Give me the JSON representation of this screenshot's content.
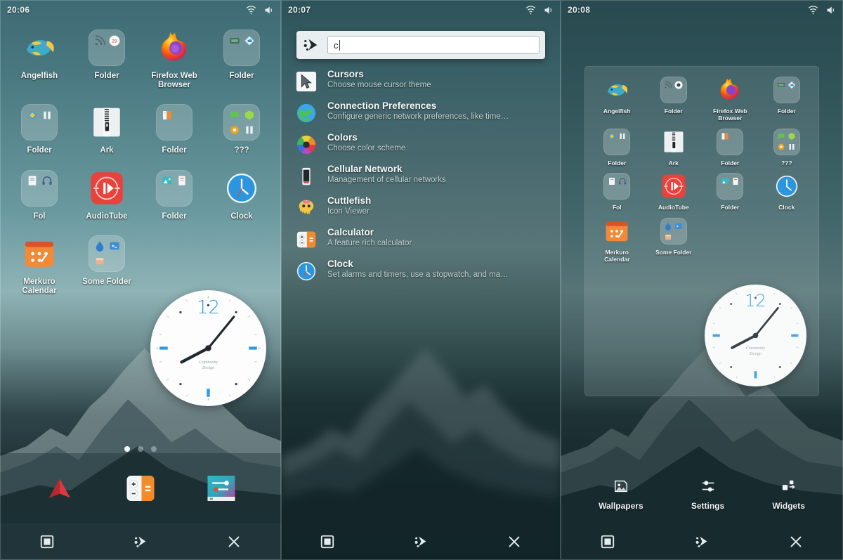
{
  "panels": [
    {
      "id": "home-screen",
      "status": {
        "time": "20:06",
        "wifi_icon": "wifi-icon",
        "volume_icon": "volume-icon"
      },
      "icons": [
        {
          "label": "Angelfish",
          "icon": "angelfish-icon",
          "kind": "app"
        },
        {
          "label": "Folder",
          "icon": "folder-group",
          "kind": "folder"
        },
        {
          "label": "Firefox Web Browser",
          "icon": "firefox-icon",
          "kind": "app"
        },
        {
          "label": "Folder",
          "icon": "folder-group",
          "kind": "folder"
        },
        {
          "label": "Folder",
          "icon": "folder-group",
          "kind": "folder"
        },
        {
          "label": "Ark",
          "icon": "ark-icon",
          "kind": "app"
        },
        {
          "label": "Folder",
          "icon": "folder-group",
          "kind": "folder"
        },
        {
          "label": "???",
          "icon": "folder-group",
          "kind": "folder"
        },
        {
          "label": "Fol",
          "icon": "folder-group",
          "kind": "folder"
        },
        {
          "label": "AudioTube",
          "icon": "audiotube-icon",
          "kind": "app"
        },
        {
          "label": "Folder",
          "icon": "folder-group",
          "kind": "folder"
        },
        {
          "label": "Clock",
          "icon": "clock-icon",
          "kind": "app"
        },
        {
          "label": "Merkuro Calendar",
          "icon": "merkuro-icon",
          "kind": "app"
        },
        {
          "label": "Some Folder",
          "icon": "folder-group",
          "kind": "folder"
        }
      ],
      "clock_widget": {
        "hour_label": "12",
        "brand_line1": "Community",
        "brand_line2": "Design"
      },
      "page_dots": {
        "count": 3,
        "active": 0
      },
      "dock": [
        {
          "name": "arrow-app-icon",
          "label": ""
        },
        {
          "name": "calculator-app-icon",
          "label": ""
        },
        {
          "name": "settings-app-icon",
          "label": ""
        }
      ],
      "nav": [
        {
          "name": "overview-button",
          "glyph": "square"
        },
        {
          "name": "home-button",
          "glyph": "kde"
        },
        {
          "name": "back-button",
          "glyph": "cross"
        }
      ]
    },
    {
      "id": "search-overlay",
      "status": {
        "time": "20:07",
        "wifi_icon": "wifi-icon",
        "volume_icon": "volume-icon"
      },
      "search": {
        "value": "c",
        "placeholder": "",
        "launcher_icon": "kde-plasma-icon"
      },
      "results": [
        {
          "name": "Cursors",
          "desc": "Choose mouse cursor theme",
          "icon": "cursor-icon"
        },
        {
          "name": "Connection Preferences",
          "desc": "Configure generic network preferences, like time…",
          "icon": "globe-icon"
        },
        {
          "name": "Colors",
          "desc": "Choose color scheme",
          "icon": "colorwheel-icon"
        },
        {
          "name": "Cellular Network",
          "desc": "Management of cellular networks",
          "icon": "phone-icon"
        },
        {
          "name": "Cuttlefish",
          "desc": "Icon Viewer",
          "icon": "cuttlefish-icon"
        },
        {
          "name": "Calculator",
          "desc": "A feature rich calculator",
          "icon": "calculator-icon"
        },
        {
          "name": "Clock",
          "desc": "Set alarms and timers, use a stopwatch, and ma…",
          "icon": "clock-icon"
        }
      ],
      "nav": [
        {
          "name": "overview-button",
          "glyph": "square"
        },
        {
          "name": "home-button",
          "glyph": "kde"
        },
        {
          "name": "back-button",
          "glyph": "cross"
        }
      ]
    },
    {
      "id": "edit-mode",
      "status": {
        "time": "20:08",
        "wifi_icon": "wifi-icon",
        "volume_icon": "volume-icon"
      },
      "icons": [
        {
          "label": "Angelfish",
          "icon": "angelfish-icon",
          "kind": "app"
        },
        {
          "label": "Folder",
          "icon": "folder-group",
          "kind": "folder"
        },
        {
          "label": "Firefox Web Browser",
          "icon": "firefox-icon",
          "kind": "app"
        },
        {
          "label": "Folder",
          "icon": "folder-group",
          "kind": "folder"
        },
        {
          "label": "Folder",
          "icon": "folder-group",
          "kind": "folder"
        },
        {
          "label": "Ark",
          "icon": "ark-icon",
          "kind": "app"
        },
        {
          "label": "Folder",
          "icon": "folder-group",
          "kind": "folder"
        },
        {
          "label": "???",
          "icon": "folder-group",
          "kind": "folder"
        },
        {
          "label": "Fol",
          "icon": "folder-group",
          "kind": "folder"
        },
        {
          "label": "AudioTube",
          "icon": "audiotube-icon",
          "kind": "app"
        },
        {
          "label": "Folder",
          "icon": "folder-group",
          "kind": "folder"
        },
        {
          "label": "Clock",
          "icon": "clock-icon",
          "kind": "app"
        },
        {
          "label": "Merkuro Calendar",
          "icon": "merkuro-icon",
          "kind": "app"
        },
        {
          "label": "Some Folder",
          "icon": "folder-group",
          "kind": "folder"
        }
      ],
      "clock_widget": {
        "hour_label": "12",
        "brand_line1": "Community",
        "brand_line2": "Design"
      },
      "edit_menu": [
        {
          "label": "Wallpapers",
          "icon": "wallpaper-icon"
        },
        {
          "label": "Settings",
          "icon": "sliders-icon"
        },
        {
          "label": "Widgets",
          "icon": "widgets-icon"
        }
      ],
      "nav": [
        {
          "name": "overview-button",
          "glyph": "square"
        },
        {
          "name": "home-button",
          "glyph": "kde"
        },
        {
          "name": "back-button",
          "glyph": "cross"
        }
      ]
    }
  ],
  "colors": {
    "accent_blue": "#2e9be0",
    "wallpaper_top": "#3e6b73",
    "wallpaper_bottom": "#16272b",
    "text_primary": "#f2f7f8",
    "text_secondary": "#c3d2d4",
    "firefox_orange": "#ff9500",
    "audiotube_red": "#e8423c",
    "merkuro_orange": "#f0762a"
  }
}
